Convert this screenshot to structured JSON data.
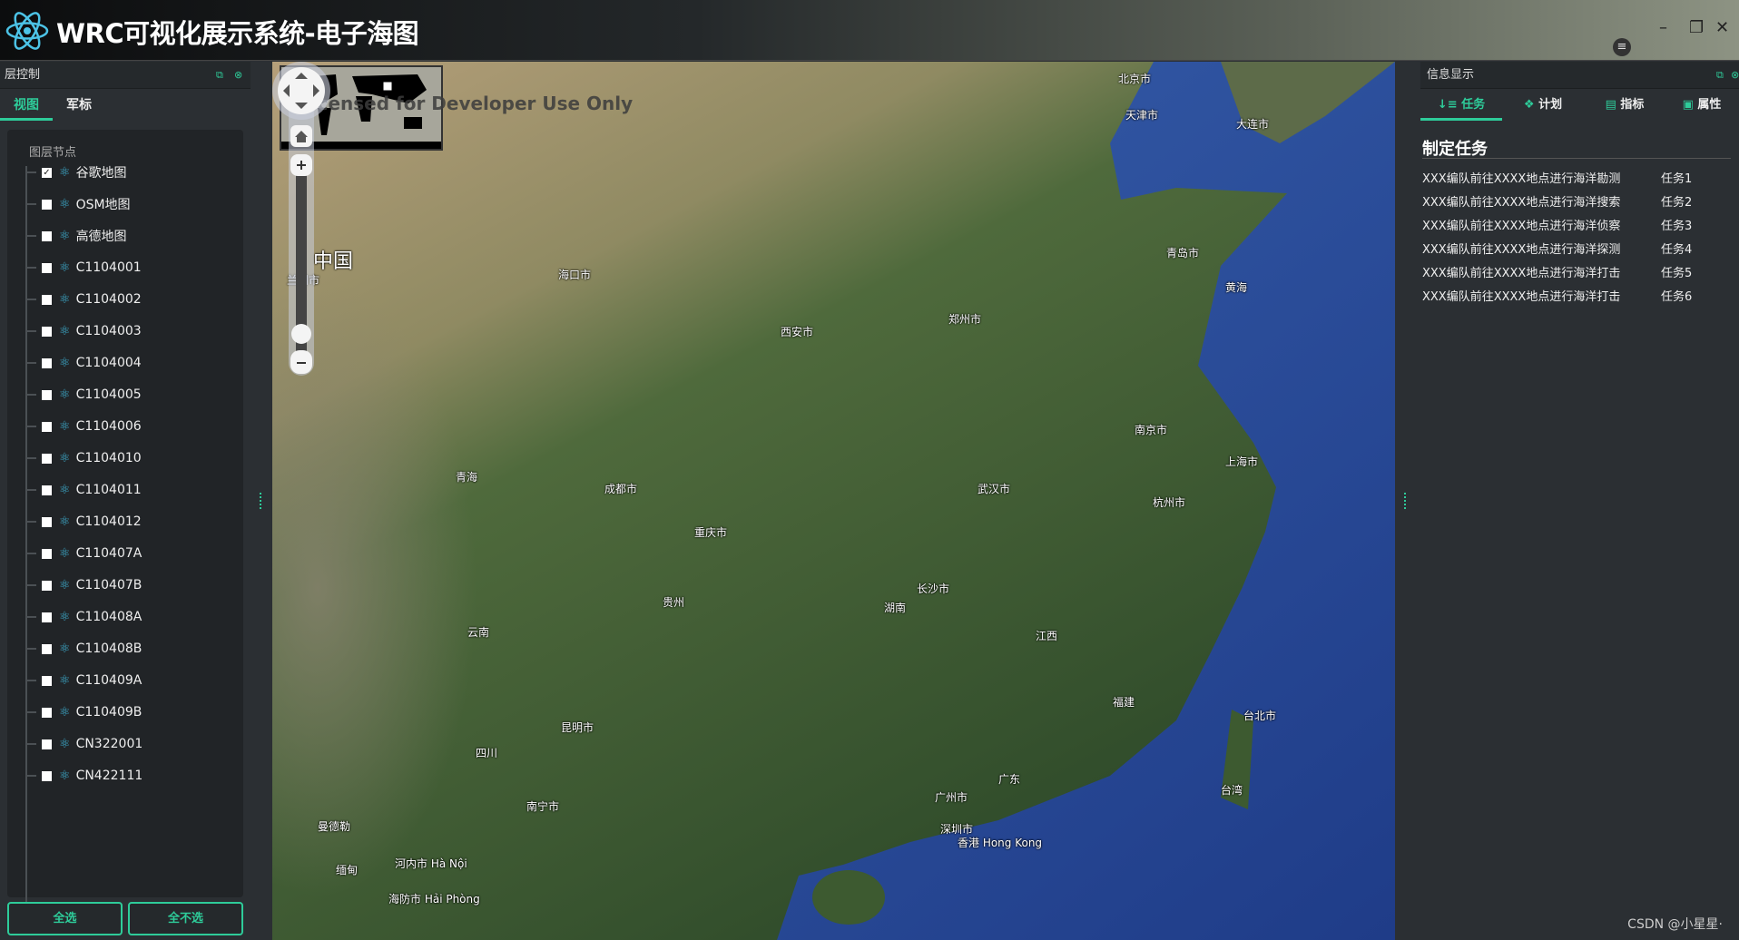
{
  "header": {
    "title": "WRC可视化展示系统-电子海图",
    "logo_icon": "react-atom-icon",
    "controls": {
      "minimize": "–",
      "restore": "❐",
      "close": "✕",
      "menu": "≡"
    }
  },
  "left_panel": {
    "title": "层控制",
    "tabs": [
      {
        "label": "视图",
        "active": true
      },
      {
        "label": "军标",
        "active": false
      }
    ],
    "tree_title": "图层节点",
    "nodes": [
      {
        "label": "谷歌地图",
        "checked": true
      },
      {
        "label": "OSM地图",
        "checked": false
      },
      {
        "label": "高德地图",
        "checked": false
      },
      {
        "label": "C1104001",
        "checked": false
      },
      {
        "label": "C1104002",
        "checked": false
      },
      {
        "label": "C1104003",
        "checked": false
      },
      {
        "label": "C1104004",
        "checked": false
      },
      {
        "label": "C1104005",
        "checked": false
      },
      {
        "label": "C1104006",
        "checked": false
      },
      {
        "label": "C1104010",
        "checked": false
      },
      {
        "label": "C1104011",
        "checked": false
      },
      {
        "label": "C1104012",
        "checked": false
      },
      {
        "label": "C110407A",
        "checked": false
      },
      {
        "label": "C110407B",
        "checked": false
      },
      {
        "label": "C110408A",
        "checked": false
      },
      {
        "label": "C110408B",
        "checked": false
      },
      {
        "label": "C110409A",
        "checked": false
      },
      {
        "label": "C110409B",
        "checked": false
      },
      {
        "label": "CN322001",
        "checked": false
      },
      {
        "label": "CN422111",
        "checked": false
      }
    ],
    "select_all": "全选",
    "select_none": "全不选"
  },
  "map": {
    "watermark": "Licensed for Developer Use Only",
    "labels": [
      {
        "t": "中国"
      },
      {
        "t": "北京市"
      },
      {
        "t": "天津市"
      },
      {
        "t": "上海市"
      },
      {
        "t": "武汉市"
      },
      {
        "t": "重庆市"
      },
      {
        "t": "成都市"
      },
      {
        "t": "西安市"
      },
      {
        "t": "郑州市"
      },
      {
        "t": "南京市"
      },
      {
        "t": "杭州市"
      },
      {
        "t": "长沙市"
      },
      {
        "t": "广州市"
      },
      {
        "t": "深圳市"
      },
      {
        "t": "香港 Hong Kong"
      },
      {
        "t": "台湾"
      },
      {
        "t": "台北市"
      },
      {
        "t": "青岛市"
      },
      {
        "t": "大连市"
      },
      {
        "t": "昆明市"
      },
      {
        "t": "南宁市"
      },
      {
        "t": "海口市"
      },
      {
        "t": "兰州市"
      },
      {
        "t": "青海"
      },
      {
        "t": "四川"
      },
      {
        "t": "云南"
      },
      {
        "t": "贵州"
      },
      {
        "t": "湖南"
      },
      {
        "t": "江西"
      },
      {
        "t": "福建"
      },
      {
        "t": "广东"
      },
      {
        "t": "黄海"
      },
      {
        "t": "河内市 Hà Nội"
      },
      {
        "t": "海防市 Hải Phòng"
      },
      {
        "t": "曼德勒"
      },
      {
        "t": "缅甸"
      }
    ],
    "colors": {
      "sea": "#2c4d9a",
      "land": "#3e5a32",
      "desert": "#a89773"
    }
  },
  "right_panel": {
    "title": "信息显示",
    "tabs": [
      {
        "label": "任务",
        "icon": "list-icon",
        "active": true
      },
      {
        "label": "计划",
        "icon": "cubes-icon"
      },
      {
        "label": "指标",
        "icon": "id-card-icon"
      },
      {
        "label": "属性",
        "icon": "contact-icon"
      }
    ],
    "section_title": "制定任务",
    "tasks": [
      {
        "desc": "XXX编队前往XXXX地点进行海洋勘测",
        "name": "任务1"
      },
      {
        "desc": "XXX编队前往XXXX地点进行海洋搜索",
        "name": "任务2"
      },
      {
        "desc": "XXX编队前往XXXX地点进行海洋侦察",
        "name": "任务3"
      },
      {
        "desc": "XXX编队前往XXXX地点进行海洋探测",
        "name": "任务4"
      },
      {
        "desc": "XXX编队前往XXXX地点进行海洋打击",
        "name": "任务5"
      },
      {
        "desc": "XXX编队前往XXXX地点进行海洋打击",
        "name": "任务6"
      }
    ]
  },
  "footer": {
    "credit": "CSDN @小星星·"
  },
  "accent": "#2ecc9a"
}
